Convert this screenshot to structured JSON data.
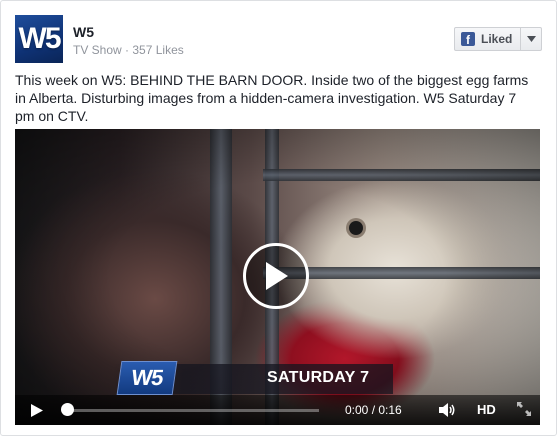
{
  "page": {
    "logo_text": "W5",
    "name": "W5",
    "category": "TV Show",
    "separator": "·",
    "likes": "357 Likes"
  },
  "like_button": {
    "icon": "facebook-icon",
    "label": "Liked",
    "caret_icon": "caret-down-icon"
  },
  "post": {
    "description": "This week on W5: BEHIND THE BARN DOOR. Inside two of the biggest egg farms in Alberta. Disturbing images from a hidden-camera investigation. W5 Saturday 7 pm on CTV."
  },
  "video": {
    "overlay_logo": "W5",
    "overlay_text": "SATURDAY 7",
    "time": "0:00 / 0:16",
    "quality": "HD",
    "progress": 0,
    "icons": [
      "play-icon",
      "volume-icon",
      "fullscreen-icon"
    ]
  },
  "colors": {
    "brand_blue": "#1f4e9c",
    "facebook_blue": "#3b5998"
  }
}
